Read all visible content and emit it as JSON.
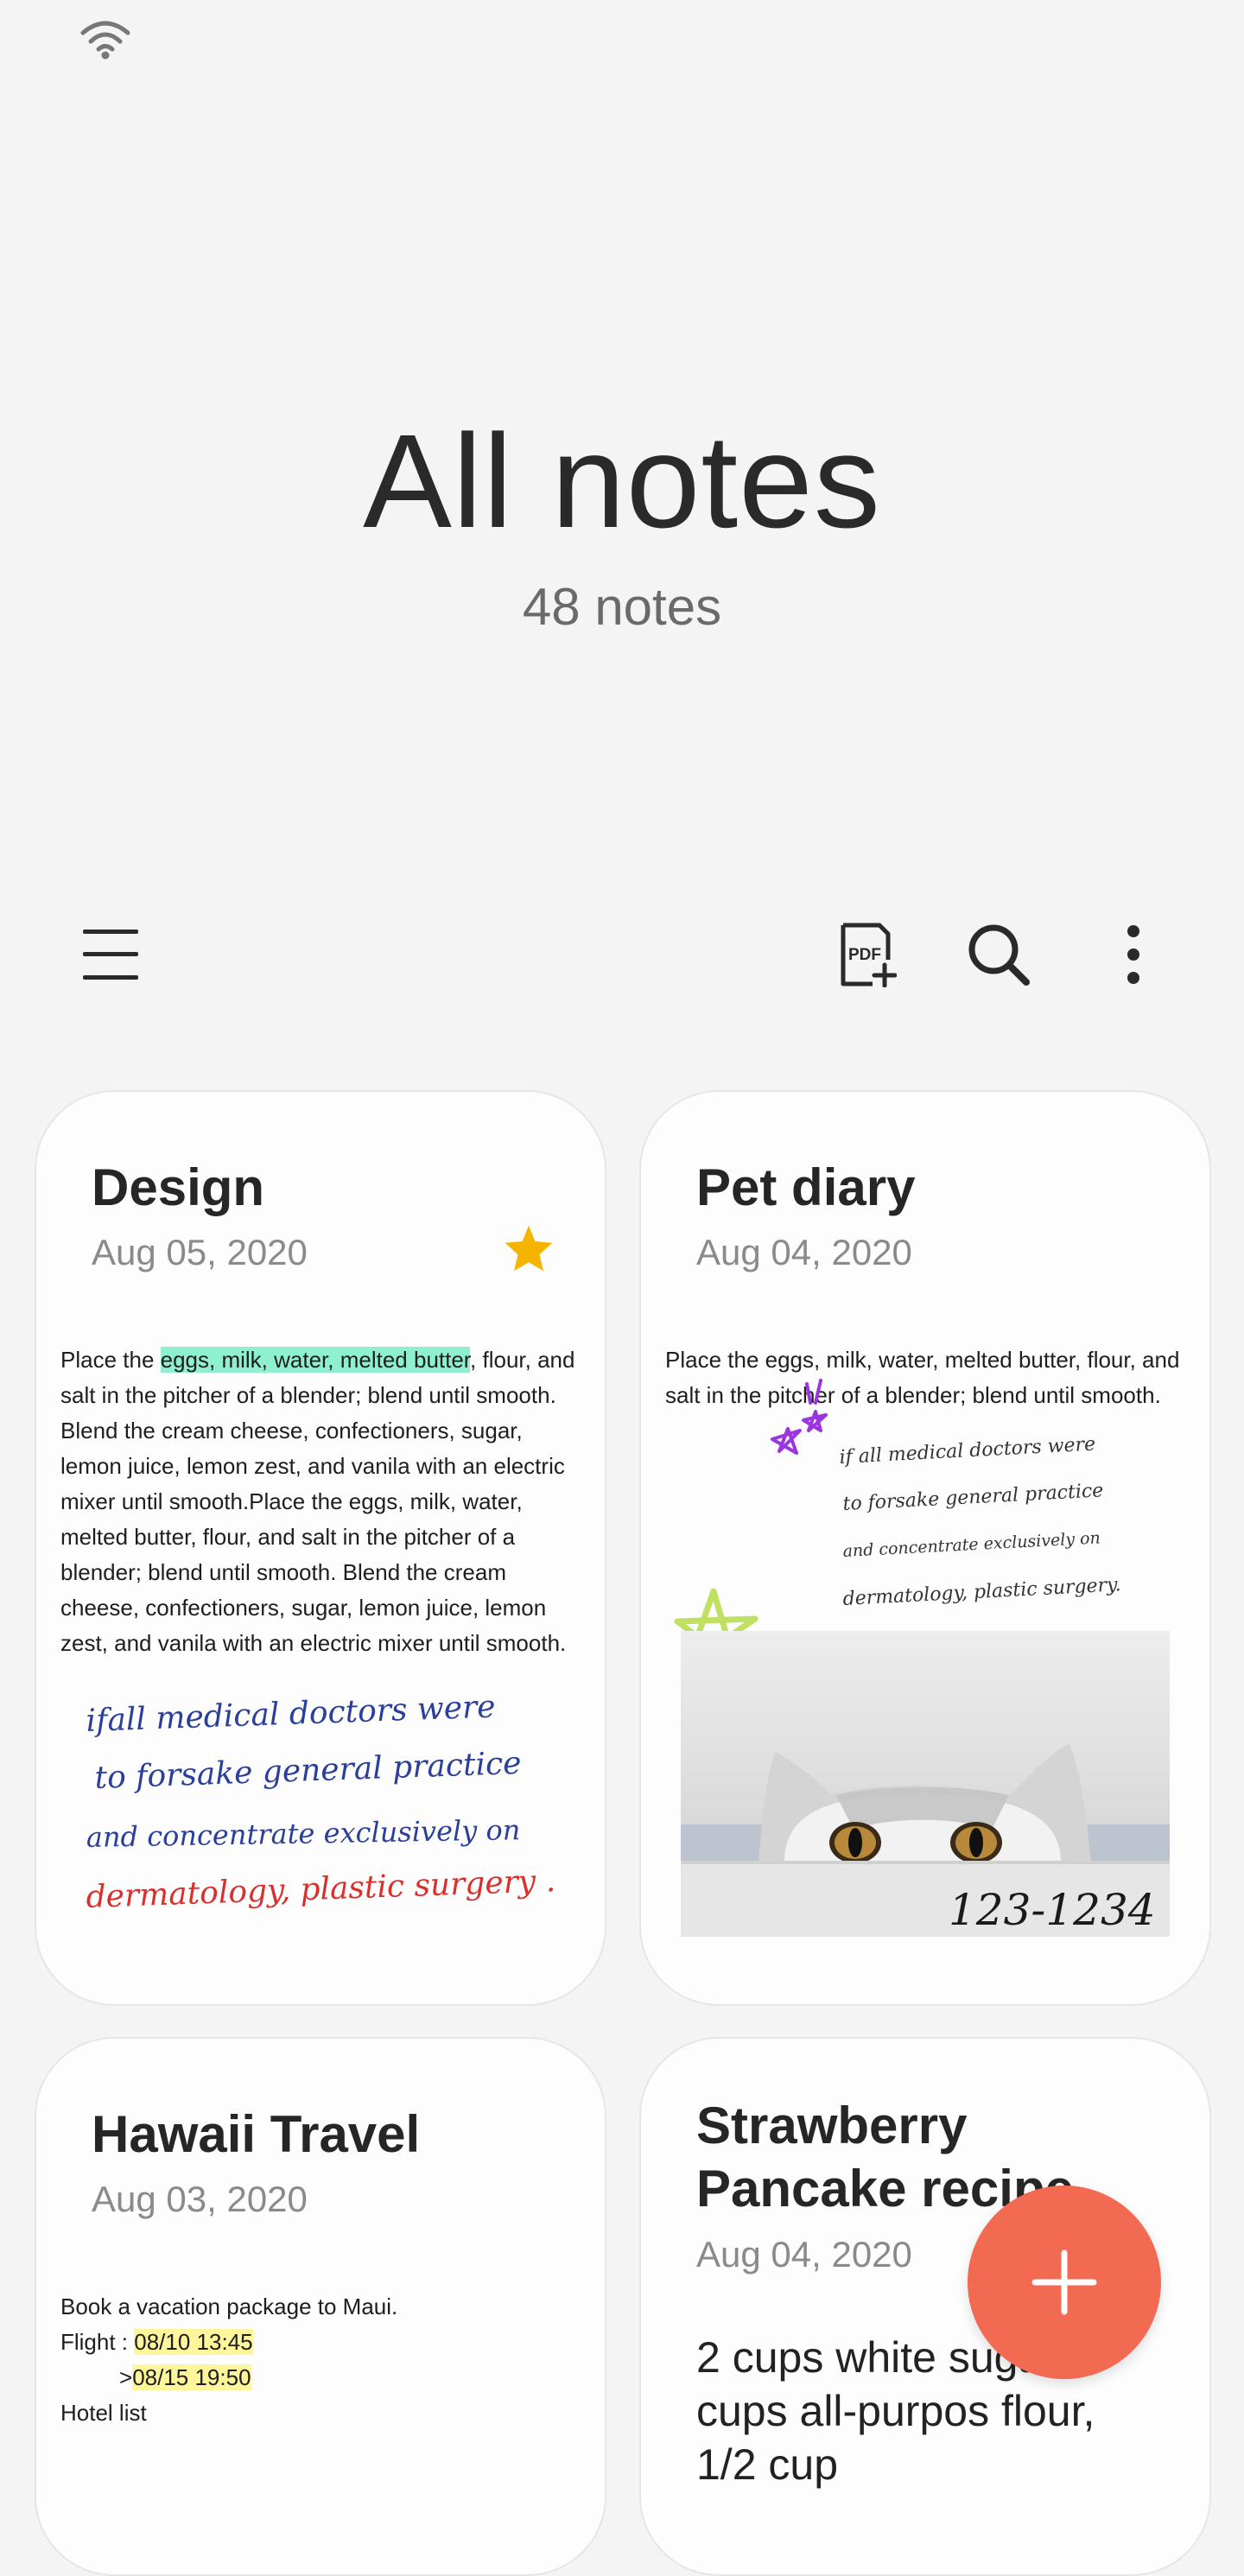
{
  "status_bar": {
    "wifi_icon": "wifi-icon"
  },
  "header": {
    "title": "All notes",
    "count": "48 notes"
  },
  "toolbar": {
    "menu_icon": "menu-icon",
    "pdf_icon": "pdf-add-icon",
    "pdf_label": "PDF",
    "search_icon": "search-icon",
    "more_icon": "more-vert-icon"
  },
  "notes": [
    {
      "title": "Design",
      "date": "Aug 05, 2020",
      "favorite": true,
      "body_pre": "Place the ",
      "body_highlight": "eggs, milk, water, melted butter",
      "body_post": ", flour, and salt in the pitcher of a blender; blend until smooth. Blend the cream cheese, confectioners, sugar, lemon juice, lemon zest, and vanila with an electric mixer until smooth.Place the eggs, milk, water, melted butter, flour, and salt in the pitcher of a blender; blend until smooth. Blend the cream cheese, confectioners, sugar, lemon juice, lemon zest, and vanila with an electric mixer until smooth.",
      "handwriting": [
        "ifall medical doctors were",
        "to forsake general practice",
        "and concentrate exclusively on",
        "dermatology, plastic surgery ."
      ]
    },
    {
      "title": "Pet diary",
      "date": "Aug 04, 2020",
      "body": "Place the eggs, milk, water, melted butter, flour, and salt in the pitcher of a blender; blend until smooth.",
      "handwriting": [
        "if all medical doctors were",
        "to forsake general practice",
        "and concentrate exclusively on",
        "dermatology, plastic surgery."
      ],
      "photo_number": "123-1234"
    },
    {
      "title": "Hawaii Travel",
      "date": "Aug 03, 2020",
      "line1": "Book a vacation package to Maui.",
      "flight_label": "Flight : ",
      "flight_out": "08/10 13:45",
      "return_prefix": ">",
      "flight_return": "08/15 19:50",
      "line4": "Hotel list"
    },
    {
      "title_line1": "Strawberry",
      "title_line2": "Pancake recipe",
      "date": "Aug 04, 2020",
      "body_lines": [
        "2 cups white sugar",
        "cups all-purpos flour,",
        "1/2 cup"
      ]
    }
  ],
  "fab": {
    "icon": "plus-icon"
  },
  "colors": {
    "accent": "#f26a52",
    "star": "#f5b400",
    "green_highlight": "#8ff0d0",
    "yellow_highlight": "#fff59a",
    "ink_blue": "#2a3f9c",
    "ink_red": "#d9302c"
  }
}
